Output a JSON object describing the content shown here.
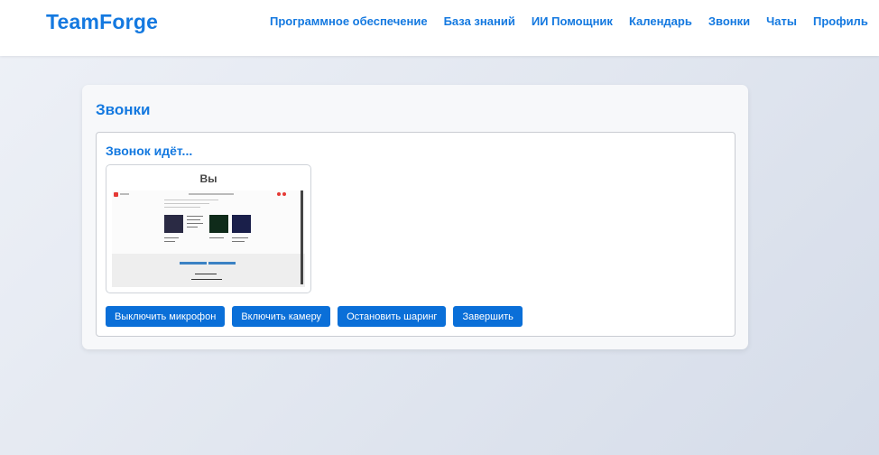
{
  "app": {
    "logo": "TeamForge"
  },
  "nav": {
    "items": [
      {
        "label": "Программное обеспечение"
      },
      {
        "label": "База знаний"
      },
      {
        "label": "ИИ Помощник"
      },
      {
        "label": "Календарь"
      },
      {
        "label": "Звонки"
      },
      {
        "label": "Чаты"
      },
      {
        "label": "Профиль"
      }
    ]
  },
  "page": {
    "title": "Звонки"
  },
  "call": {
    "status": "Звонок идёт...",
    "tile_label": "Вы",
    "buttons": {
      "mic": "Выключить микрофон",
      "camera": "Включить камеру",
      "share": "Остановить шаринг",
      "end": "Завершить"
    }
  },
  "colors": {
    "accent": "#1479e0",
    "button": "#0a6fd8",
    "background": "#e2e7f0"
  }
}
